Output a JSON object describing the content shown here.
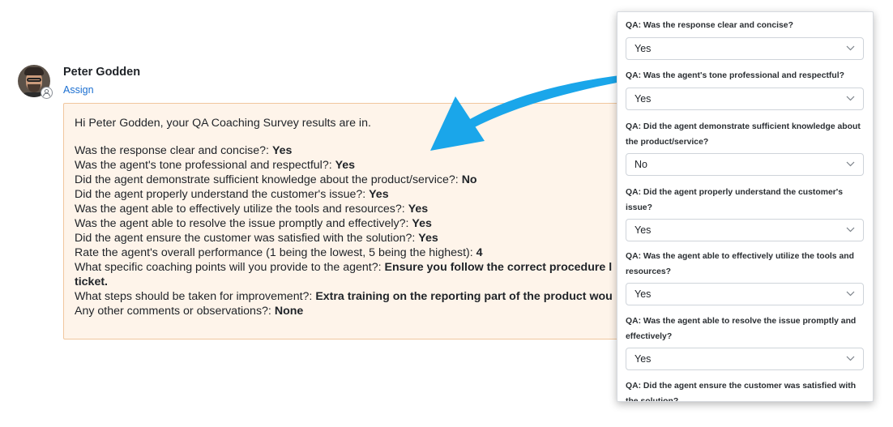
{
  "user": {
    "name": "Peter Godden",
    "assign_label": "Assign"
  },
  "message": {
    "greeting": "Hi Peter Godden, your QA Coaching Survey results are in.",
    "lines": [
      {
        "q": "Was the response clear and concise?: ",
        "a": "Yes"
      },
      {
        "q": "Was the agent's tone professional and respectful?: ",
        "a": "Yes"
      },
      {
        "q": "Did the agent demonstrate sufficient knowledge about the product/service?: ",
        "a": "No"
      },
      {
        "q": "Did the agent properly understand the customer's issue?: ",
        "a": "Yes"
      },
      {
        "q": "Was the agent able to effectively utilize the tools and resources?: ",
        "a": "Yes"
      },
      {
        "q": "Was the agent able to resolve the issue promptly and effectively?: ",
        "a": "Yes"
      },
      {
        "q": "Did the agent ensure the customer was satisfied with the solution?: ",
        "a": "Yes"
      },
      {
        "q": "Rate the agent's overall performance (1 being the lowest, 5 being the highest): ",
        "a": "4"
      },
      {
        "q": "What specific coaching points will you provide to the agent?: ",
        "a": "Ensure you follow the correct procedure l"
      },
      {
        "q": "",
        "a": "ticket."
      },
      {
        "q": "What steps should be taken for improvement?: ",
        "a": "Extra training on the reporting part of the product wou"
      },
      {
        "q": "Any other comments or observations?: ",
        "a": "None"
      }
    ]
  },
  "panel": {
    "questions": [
      {
        "label": "QA: Was the response clear and concise?",
        "value": "Yes"
      },
      {
        "label": "QA: Was the agent's tone professional and respectful?",
        "value": "Yes"
      },
      {
        "label": "QA: Did the agent demonstrate sufficient knowledge about the product/service?",
        "value": "No"
      },
      {
        "label": "QA: Did the agent properly understand the customer's issue?",
        "value": "Yes"
      },
      {
        "label": "QA: Was the agent able to effectively utilize the tools and resources?",
        "value": "Yes"
      },
      {
        "label": "QA: Was the agent able to resolve the issue promptly and effectively?",
        "value": "Yes"
      },
      {
        "label": "QA: Did the agent ensure the customer was satisfied with the solution?",
        "value": ""
      }
    ]
  },
  "colors": {
    "accent_link": "#1b6fd1",
    "arrow": "#1aa6ea",
    "message_bg": "#fef4ea",
    "message_border": "#f1c79e"
  },
  "icons": {
    "dropdown": "chevron-down-icon",
    "presence": "person-icon"
  }
}
